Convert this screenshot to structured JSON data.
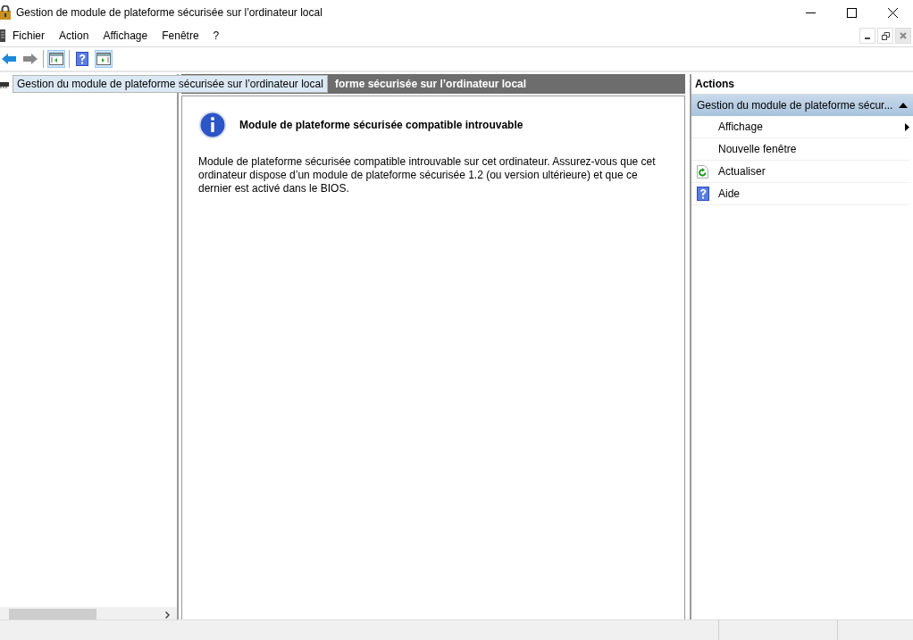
{
  "window": {
    "title": "Gestion de module de plateforme sécurisée sur l’ordinateur local"
  },
  "menu": [
    "Fichier",
    "Action",
    "Affichage",
    "Fenêtre",
    "?"
  ],
  "toolbar": [
    {
      "kind": "back"
    },
    {
      "kind": "forward"
    },
    {
      "kind": "sep"
    },
    {
      "kind": "pane-left",
      "selected": true
    },
    {
      "kind": "sep"
    },
    {
      "kind": "help",
      "selected": false
    },
    {
      "kind": "pane-right",
      "selected": true
    }
  ],
  "tree": {
    "items": [
      {
        "label": "Gestion du module de plateforme sécurisée sur l’ordinateur local",
        "selected": true
      }
    ]
  },
  "content": {
    "header": "forme sécurisée sur l’ordinateur local",
    "message_title": "Module de plateforme sécurisée compatible introuvable",
    "message": "Module de plateforme sécurisée compatible introuvable sur cet ordinateur. Assurez-vous que cet ordinateur dispose d’un module de plateforme sécurisée 1.2 (ou version ultérieure) et que ce dernier est activé dans le BIOS."
  },
  "actions": {
    "title": "Actions",
    "section": "Gestion du module de plateforme sécur...",
    "items": [
      {
        "label": "Affichage",
        "kind": "submenu"
      },
      {
        "label": "Nouvelle fenêtre",
        "kind": "plain"
      },
      {
        "label": "Actualiser",
        "kind": "refresh"
      },
      {
        "label": "Aide",
        "kind": "help"
      }
    ]
  }
}
